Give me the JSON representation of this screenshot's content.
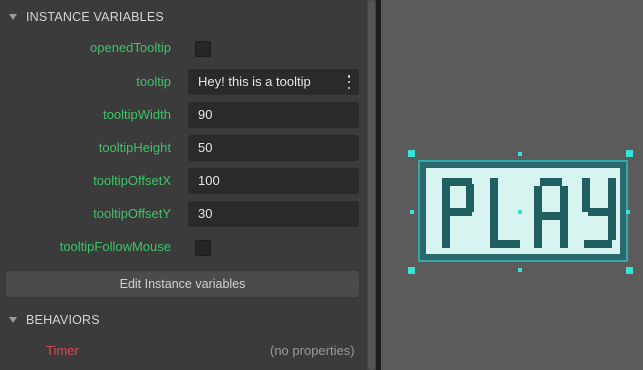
{
  "instance_variables": {
    "header": "INSTANCE VARIABLES",
    "rows": [
      {
        "name": "openedTooltip",
        "type": "checkbox",
        "checked": false
      },
      {
        "name": "tooltip",
        "type": "text",
        "value": "Hey! this is a tooltip"
      },
      {
        "name": "tooltipWidth",
        "type": "number",
        "value": "90"
      },
      {
        "name": "tooltipHeight",
        "type": "number",
        "value": "50"
      },
      {
        "name": "tooltipOffsetX",
        "type": "number",
        "value": "100"
      },
      {
        "name": "tooltipOffsetY",
        "type": "number",
        "value": "30"
      },
      {
        "name": "tooltipFollowMouse",
        "type": "checkbox",
        "checked": false
      }
    ],
    "edit_button": "Edit Instance variables"
  },
  "behaviors": {
    "header": "BEHAVIORS",
    "items": [
      {
        "name": "Timer",
        "properties": "(no properties)"
      }
    ]
  },
  "scene": {
    "object_text": "PLAY",
    "colors": {
      "frame": "#2a6a6e",
      "fill": "#d8f4f0",
      "handles": "#37e2d9",
      "letters": "#1f5f62"
    }
  },
  "colors": {
    "label": "#3cc467",
    "behavior": "#e0474f",
    "panel": "#3b3b3b",
    "canvas": "#5b5b5b"
  }
}
